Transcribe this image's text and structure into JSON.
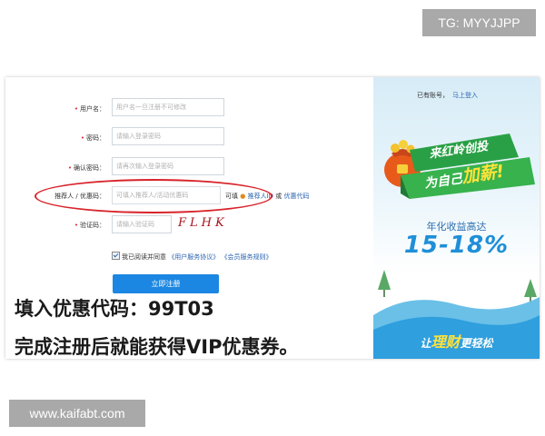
{
  "watermark_top": "TG: MYYJJPP",
  "watermark_bottom": "www.kaifabt.com",
  "form": {
    "username_label": "用户名：",
    "username_placeholder": "用户名一旦注册不可修改",
    "password_label": "密码：",
    "password_placeholder": "请输入登录密码",
    "confirm_label": "确认密码：",
    "confirm_placeholder": "请再次输入登录密码",
    "referrer_label": "推荐人 / 优惠码：",
    "referrer_placeholder": "可填入推荐人/活动优惠码",
    "referrer_hint_optional": "可填",
    "referrer_link_1": "推荐人ID",
    "referrer_or": "或",
    "referrer_link_2": "优惠代码",
    "captcha_label": "验证码：",
    "captcha_placeholder": "请输入验证码",
    "captcha_text": "FLHK",
    "agree_text": "我已阅读并同意",
    "agree_link_1": "《用户服务协议》",
    "agree_link_2": "《会员服务规则》",
    "submit_label": "立即注册"
  },
  "overlay": {
    "line1": "填入优惠代码：99T03",
    "line2": "完成注册后就能获得VIP优惠券。"
  },
  "promo": {
    "have_account": "已有账号，",
    "login_link": "马上登入",
    "banner_line1": "来红岭创投",
    "banner_line2_a": "为自己",
    "banner_line2_b": "加薪!",
    "rate_label": "年化收益高达",
    "rate_value": "15-18%",
    "slogan_a": "让",
    "slogan_b": "理财",
    "slogan_c": "更轻松"
  },
  "colors": {
    "accent_blue": "#1b87e2",
    "highlight_red": "#d8232a",
    "banner_green": "#2aa046",
    "badge_gray": "#a9a9a9"
  }
}
